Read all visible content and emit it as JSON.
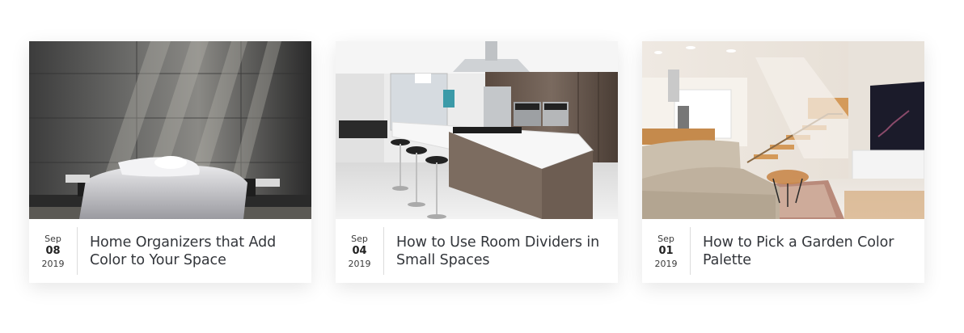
{
  "posts": [
    {
      "image_alt": "Concrete-wall bedroom with white bed",
      "month": "Sep",
      "day": "08",
      "year": "2019",
      "title": "Home Organizers that Add Color to Your Space"
    },
    {
      "image_alt": "Modern kitchen with island and bar stools",
      "month": "Sep",
      "day": "04",
      "year": "2019",
      "title": "How to Use Room Dividers in Small Spaces"
    },
    {
      "image_alt": "Living room with sofa, staircase and TV",
      "month": "Sep",
      "day": "01",
      "year": "2019",
      "title": "How to Pick a Garden Color Palette"
    }
  ]
}
